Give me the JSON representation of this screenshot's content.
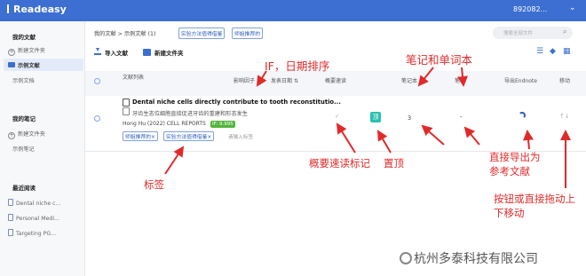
{
  "app": {
    "logo": "Readeasy",
    "user": "892082..."
  },
  "sidebar": {
    "my_docs": "我的文献",
    "new_folder": "新建文件夹",
    "sample_docs": "示例文献",
    "sample_folder": "示例文档",
    "my_notes": "我的笔记",
    "notes_new_folder": "新建文件夹",
    "sample_notes": "示例笔记",
    "recent": "最近阅读",
    "recent_items": [
      "Dental niche c...",
      "Personal Medi...",
      "Targeting PG..."
    ]
  },
  "breadcrumb": {
    "root": "我的文献",
    "sep": ">",
    "current": "示例文献",
    "count": "(1)"
  },
  "filters": [
    "实验方法值得借鉴",
    "师姐推荐的"
  ],
  "search": {
    "placeholder": "搜索全部文件"
  },
  "toolbar": {
    "import": "导入文献",
    "new_folder": "新建文件夹"
  },
  "columns": {
    "list": "文献列表",
    "impact": "影响因子",
    "date": "发表日期",
    "summary": "概要速读",
    "notes_words": "笔记本",
    "notes": "笔记",
    "export": "导出Endnote",
    "move": "移动"
  },
  "row": {
    "title": "Dental niche cells directly contribute to tooth reconstitutio...",
    "subtitle": "牙齿生态位细胞直接促进牙齿的重建和形态发生",
    "author": "Hong Hu (2022) CELL REPORTS",
    "if_label": "IF: 9.995",
    "tags": [
      "师姐推荐的",
      "实验方法值得借鉴"
    ],
    "tag_input_placeholder": "请输入标签",
    "pin_label": "顶",
    "notes_count": "3",
    "notes_dash": "-"
  },
  "annotations": {
    "if_sort": "IF，日期排序",
    "notes_words": "笔记和单词本",
    "summary_mark": "概要速读标记",
    "pin": "置顶",
    "export": "直接导出为\n参考文献",
    "move": "按钮或直接拖动上\n下移动",
    "tags": "标签"
  },
  "watermark": "杭州多泰科技有限公司",
  "colors": {
    "brand": "#3c6fd1",
    "annotation": "#e02a2a",
    "if_badge": "#52b43b",
    "pin": "#2bc0b0"
  }
}
